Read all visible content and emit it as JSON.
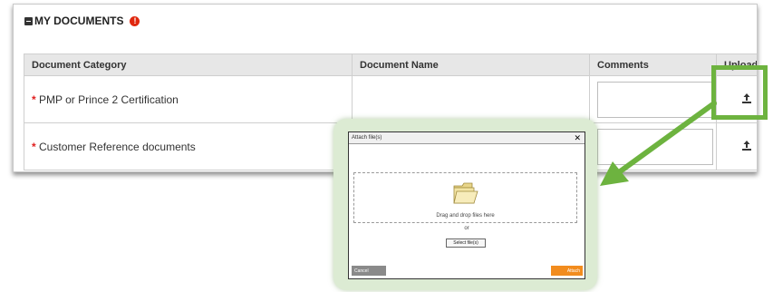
{
  "section": {
    "title": "MY DOCUMENTS",
    "alert_symbol": "!"
  },
  "table": {
    "headers": [
      "Document Category",
      "Document Name",
      "Comments",
      "Upload"
    ],
    "rows": [
      {
        "required_mark": "*",
        "category": "PMP or Prince 2 Certification",
        "document_name": ""
      },
      {
        "required_mark": "*",
        "category": "Customer Reference documents",
        "document_name": ""
      }
    ]
  },
  "dialog": {
    "title": "Attach file(s)",
    "close_symbol": "✕",
    "drop_text": "Drag and drop files here",
    "or_text": "or",
    "select_button": "Select file(s)",
    "cancel_button": "Cancel",
    "attach_button": "Attach"
  },
  "colors": {
    "highlight_green": "#6db33f",
    "required_red": "#e02020",
    "attach_orange": "#f28c1e",
    "alert_red": "#e0280f"
  }
}
